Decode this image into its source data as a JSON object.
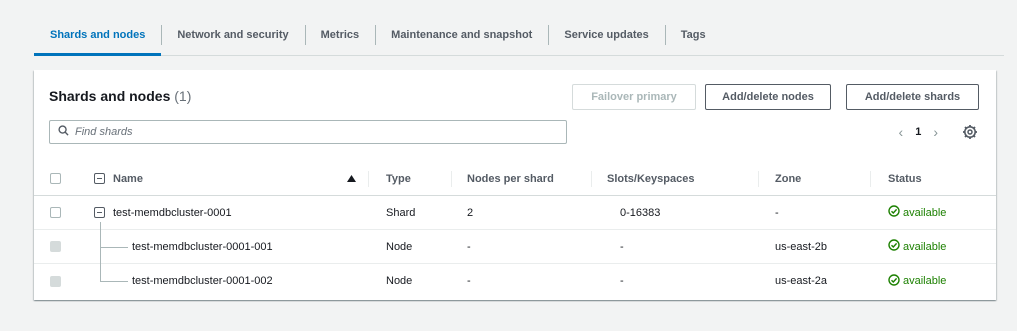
{
  "tabs": [
    {
      "label": "Shards and nodes",
      "active": true
    },
    {
      "label": "Network and security"
    },
    {
      "label": "Metrics"
    },
    {
      "label": "Maintenance and snapshot"
    },
    {
      "label": "Service updates"
    },
    {
      "label": "Tags"
    }
  ],
  "panel": {
    "title": "Shards and nodes",
    "count": "(1)",
    "buttons": {
      "failover": "Failover primary",
      "add_delete_nodes": "Add/delete nodes",
      "add_delete_shards": "Add/delete shards"
    },
    "search_placeholder": "Find shards",
    "pagination": {
      "page": "1"
    }
  },
  "table": {
    "headers": {
      "name": "Name",
      "type": "Type",
      "nodes_per_shard": "Nodes per shard",
      "slots": "Slots/Keyspaces",
      "zone": "Zone",
      "status": "Status"
    },
    "rows": [
      {
        "name": "test-memdbcluster-0001",
        "type": "Shard",
        "nodes": "2",
        "slots": "0-16383",
        "zone": "-",
        "status": "available"
      },
      {
        "name": "test-memdbcluster-0001-001",
        "type": "Node",
        "nodes": "-",
        "slots": "-",
        "zone": "us-east-2b",
        "status": "available"
      },
      {
        "name": "test-memdbcluster-0001-002",
        "type": "Node",
        "nodes": "-",
        "slots": "-",
        "zone": "us-east-2a",
        "status": "available"
      }
    ]
  },
  "colors": {
    "accent": "#0073bb",
    "success": "#1d8102"
  }
}
